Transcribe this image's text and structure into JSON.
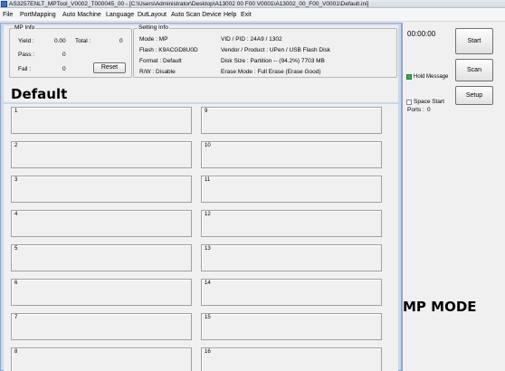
{
  "window": {
    "title": "AS3257ENLT_MPTool_V0002_T000045_00 - [C:\\Users\\Administrator\\Desktop\\A13002 00 F00 V0001\\A13002_00_F00_V0001\\Default.ini]"
  },
  "menu": [
    "File",
    "PortMapping",
    "Auto Machine",
    "Language",
    "DutLayout",
    "Auto Scan Device",
    "Help",
    "Exit"
  ],
  "mp_info": {
    "title": "MP Info",
    "yield_label": "Yield :",
    "yield_value": "0.00",
    "total_label": "Total :",
    "total_value": "0",
    "pass_label": "Pass :",
    "pass_value": "0",
    "fail_label": "Fail :",
    "fail_value": "0",
    "reset_label": "Reset"
  },
  "setting_info": {
    "title": "Setting Info",
    "mode": "Mode : MP",
    "flash": "Flash : K9ACGD8U0D",
    "format": "Format : Default",
    "rw": "R/W : Disable",
    "vidpid": "VID / PID : 24A9 / 1302",
    "vendor": "Vendor / Product : UPen / USB Flash Disk",
    "disk_size": "Disk Size : Partition -- (94.2%) 7703 MB",
    "erase_mode": "Erase Mode : Full Erase (Erase Good)"
  },
  "default_title": "Default",
  "ports_left": [
    "1",
    "2",
    "3",
    "4",
    "5",
    "6",
    "7",
    "8"
  ],
  "ports_right": [
    "9",
    "10",
    "11",
    "12",
    "13",
    "14",
    "15",
    "16"
  ],
  "right_panel": {
    "timer": "00:00:00",
    "start_label": "Start",
    "scan_label": "Scan",
    "hold_message_label": "Hold Message",
    "setup_label": "Setup",
    "space_start_label": "Space Start",
    "ports_label": "Ports :",
    "ports_value": "0",
    "mp_mode": "MP MODE",
    "hold_message_color": "#3aa84e"
  }
}
